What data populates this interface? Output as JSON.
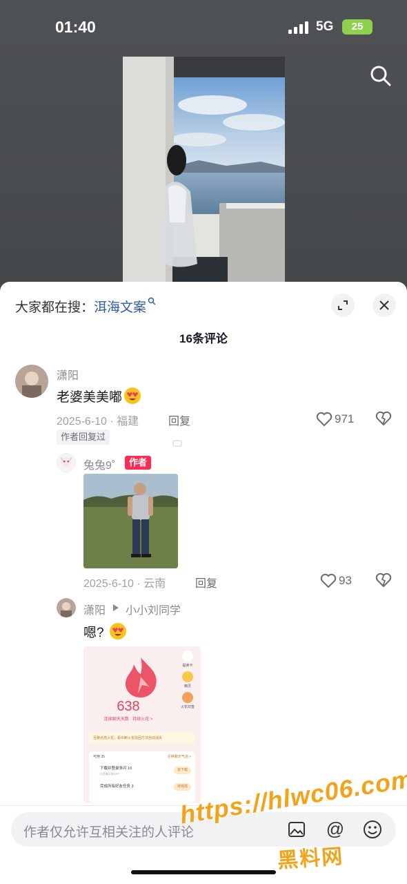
{
  "status_bar": {
    "time": "01:40",
    "network": "5G",
    "battery": "25"
  },
  "comments_panel": {
    "trending_prefix": "大家都在搜：",
    "trending_query": "洱海文案",
    "count_label": "16条评论"
  },
  "comments": [
    {
      "user": "潇阳",
      "text": "老婆美美嘟",
      "date_location": "2025-6-10 · 福建",
      "reply_label": "回复",
      "likes": "971",
      "badge": "作者回复过"
    },
    {
      "user": "兔兔9˚",
      "author_tag": "作者",
      "date_location": "2025-6-10 · 云南",
      "reply_label": "回复",
      "likes": "93"
    },
    {
      "user": "潇阳",
      "reply_to": "小小刘同学",
      "text": "嗯?"
    }
  ],
  "shared_screenshot": {
    "streak_number": "638",
    "streak_label": "连续聊天天数 · 持续火花 >",
    "side_items": [
      "提卖卡",
      "精灵",
      "火花日签"
    ],
    "promo": "互聊点亮火花，看中断火花找回方法自动消失",
    "task_header": "可用 35",
    "task_header_right": "兑换聊天气泡 >",
    "tasks": [
      {
        "title": "下载并登录多闪 10",
        "sub": "抖音聊天新APP",
        "button": "去下载"
      },
      {
        "title": "完成所有好友任务 3",
        "sub": "",
        "button": "待完成"
      }
    ]
  },
  "input": {
    "placeholder": "作者仅允许互相关注的人评论"
  },
  "watermark": {
    "url": "https://hlwc06.com",
    "name": "黑料网"
  }
}
